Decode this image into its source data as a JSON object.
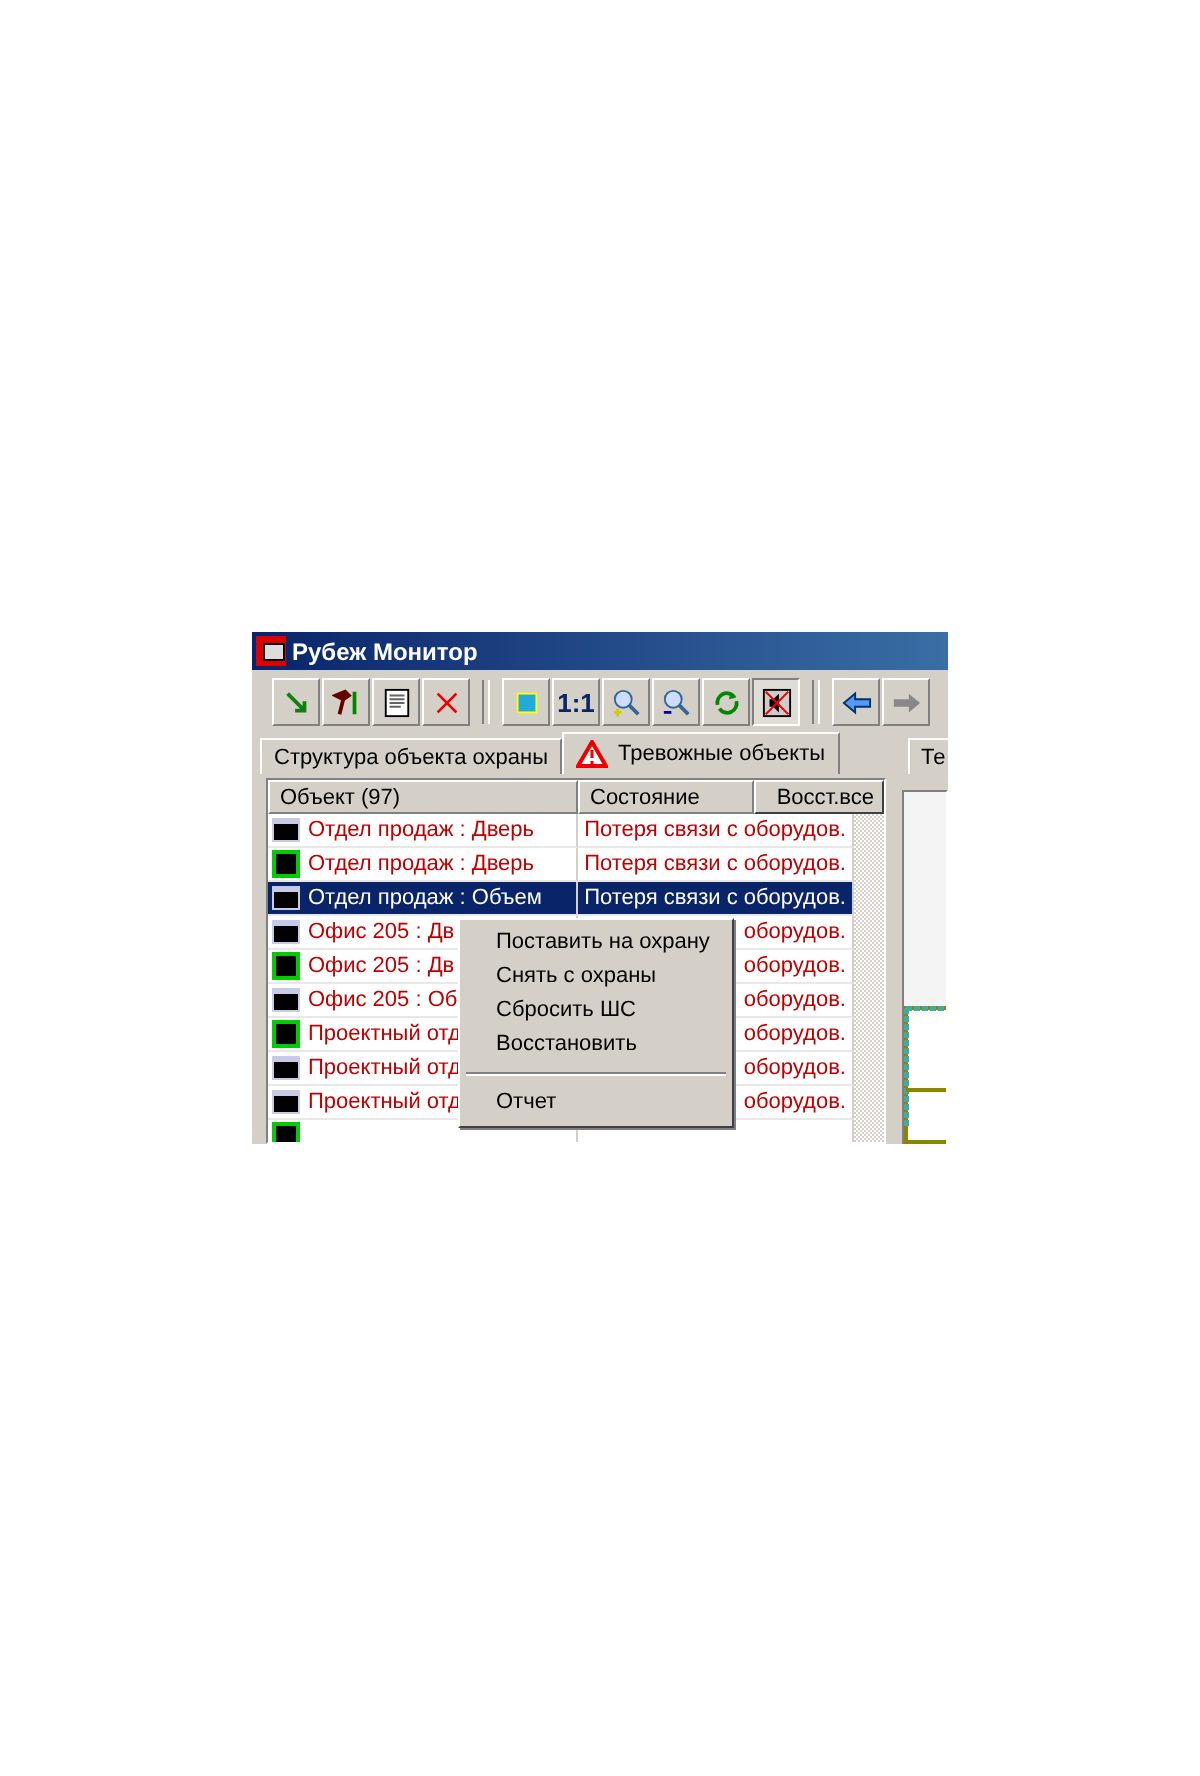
{
  "window": {
    "title": "Рубеж Монитор"
  },
  "toolbar": [
    {
      "kind": "arrow"
    },
    {
      "kind": "tools"
    },
    {
      "kind": "document"
    },
    {
      "kind": "cross"
    },
    {
      "kind": "separator"
    },
    {
      "kind": "square"
    },
    {
      "kind": "text",
      "label": "1:1"
    },
    {
      "kind": "zoomin"
    },
    {
      "kind": "zoomout"
    },
    {
      "kind": "refresh"
    },
    {
      "kind": "mute",
      "selected": true
    },
    {
      "kind": "separator"
    },
    {
      "kind": "back"
    },
    {
      "kind": "forward"
    }
  ],
  "tabs": [
    {
      "label": "Структура объекта охраны",
      "selected": false,
      "alert": false
    },
    {
      "label": "Тревожные объекты",
      "selected": true,
      "alert": true
    },
    {
      "label": "Те",
      "selected": false,
      "alert": false
    }
  ],
  "table": {
    "columns": [
      "Объект (97)",
      "Состояние"
    ],
    "restore_button": "Восст.все",
    "rows": [
      {
        "kind": "plain",
        "object": "Отдел продаж : Дверь",
        "state": "Потеря связи с оборудов.",
        "selected": false
      },
      {
        "kind": "framed",
        "object": "Отдел продаж : Дверь",
        "state": "Потеря связи с оборудов.",
        "selected": false
      },
      {
        "kind": "plain",
        "object": "Отдел продаж : Объем",
        "state": "Потеря связи с оборудов.",
        "selected": true
      },
      {
        "kind": "plain",
        "object": "Офис 205 : Дв",
        "state": "оборудов.",
        "selected": false
      },
      {
        "kind": "framed",
        "object": "Офис 205 : Дв",
        "state": "оборудов.",
        "selected": false
      },
      {
        "kind": "plain",
        "object": "Офис 205 : Об",
        "state": "оборудов.",
        "selected": false
      },
      {
        "kind": "framed",
        "object": "Проектный отд",
        "state": "оборудов.",
        "selected": false
      },
      {
        "kind": "plain",
        "object": "Проектный отд",
        "state": "оборудов.",
        "selected": false
      },
      {
        "kind": "plain",
        "object": "Проектный отд",
        "state": "оборудов.",
        "selected": false
      },
      {
        "kind": "framed",
        "selected": false
      }
    ]
  },
  "context_menu": [
    {
      "kind": "item",
      "label": "Поставить на охрану"
    },
    {
      "kind": "item",
      "label": "Снять с охраны"
    },
    {
      "kind": "item",
      "label": "Сбросить ШС"
    },
    {
      "kind": "item",
      "label": "Восстановить"
    },
    {
      "kind": "separator"
    },
    {
      "kind": "item",
      "label": "Отчет"
    }
  ]
}
